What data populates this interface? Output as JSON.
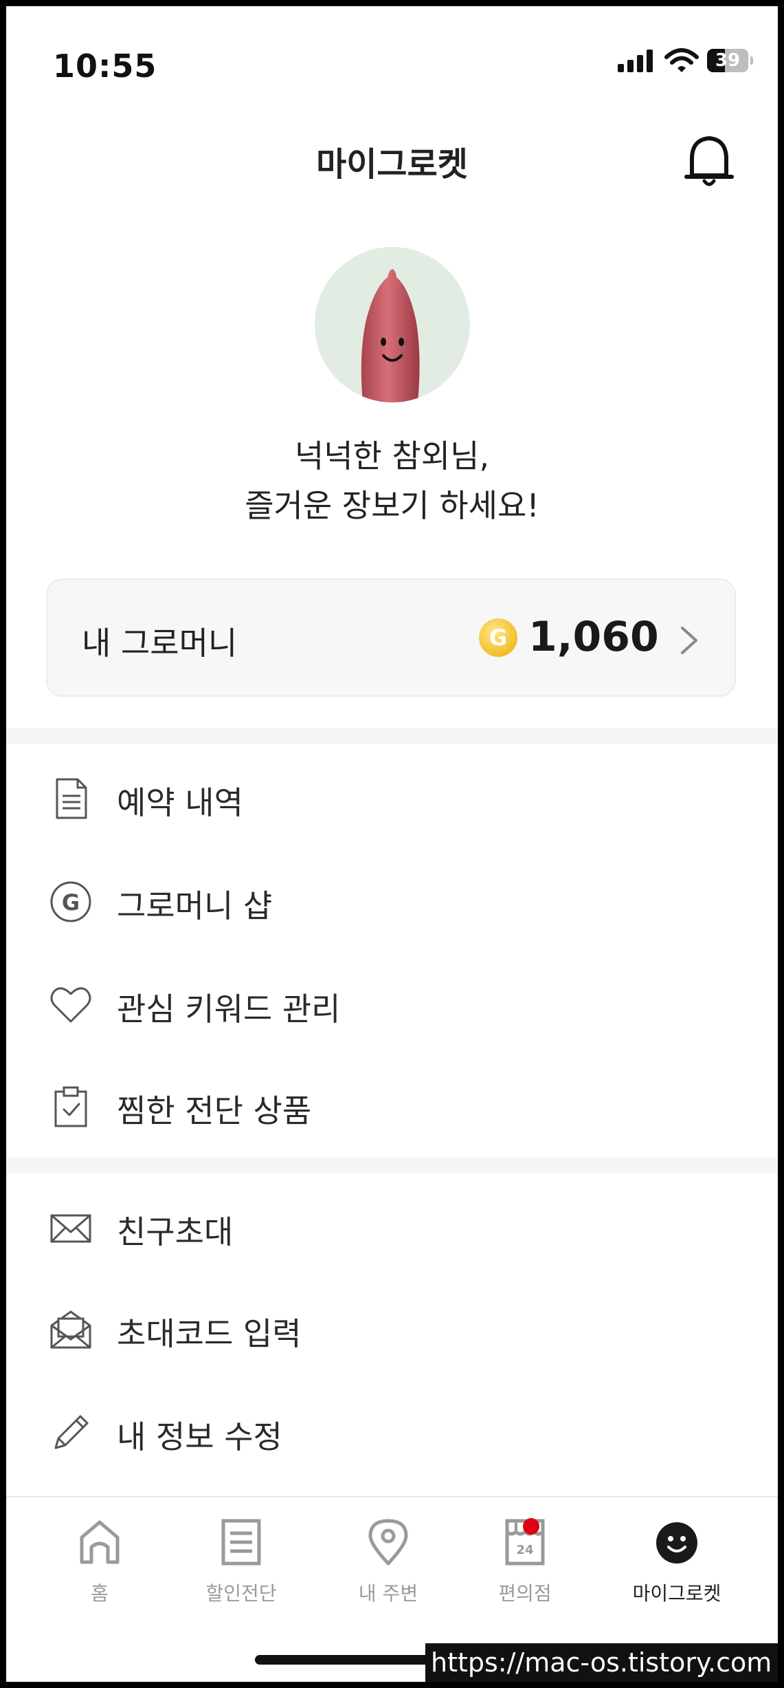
{
  "status": {
    "time": "10:55",
    "battery": "39"
  },
  "header": {
    "title": "마이그로켓"
  },
  "profile": {
    "greeting_line1": "넉넉한 참외님,",
    "greeting_line2": "즐거운 장보기 하세요!"
  },
  "money": {
    "label": "내 그로머니",
    "coin_symbol": "G",
    "amount": "1,060"
  },
  "menu_group1": [
    {
      "label": "예약 내역",
      "icon": "document-icon"
    },
    {
      "label": "그로머니 샵",
      "icon": "g-coin-icon"
    },
    {
      "label": "관심 키워드 관리",
      "icon": "heart-icon"
    },
    {
      "label": "찜한 전단 상품",
      "icon": "clipboard-check-icon"
    }
  ],
  "menu_group2": [
    {
      "label": "친구초대",
      "icon": "envelope-icon"
    },
    {
      "label": "초대코드 입력",
      "icon": "open-envelope-icon"
    },
    {
      "label": "내 정보 수정",
      "icon": "pencil-icon"
    }
  ],
  "tabs": [
    {
      "label": "홈",
      "icon": "home-icon"
    },
    {
      "label": "할인전단",
      "icon": "flyer-icon"
    },
    {
      "label": "내 주변",
      "icon": "location-pin-icon"
    },
    {
      "label": "편의점",
      "icon": "convenience-store-icon",
      "store_number": "24"
    },
    {
      "label": "마이그로켓",
      "icon": "smiley-icon"
    }
  ],
  "colors": {
    "accent_dot": "#e00012",
    "card_bg": "#f7f7f7",
    "avatar_bg": "#e3ece3"
  },
  "watermark": "https://mac-os.tistory.com"
}
